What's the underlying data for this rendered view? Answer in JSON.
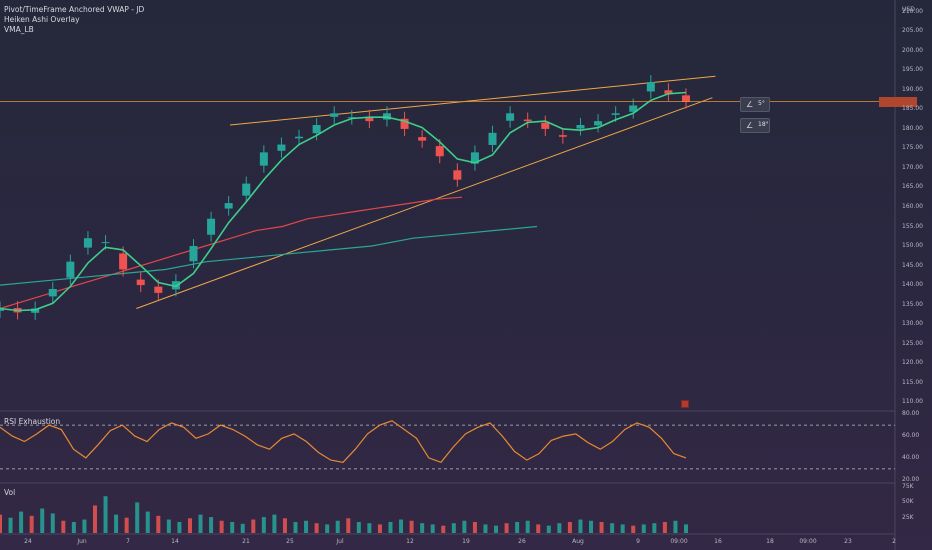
{
  "header": {
    "indicators": [
      "Pivot/TimeFrame Anchored VWAP - JD",
      "Heiken Ashi Overlay",
      "VMA_LB"
    ]
  },
  "price_axis": {
    "currency": "USD",
    "ticks": [
      "210.00",
      "205.00",
      "200.00",
      "195.00",
      "190.00",
      "185.00",
      "180.00",
      "175.00",
      "170.00",
      "165.00",
      "160.00",
      "155.00",
      "150.00",
      "145.00",
      "140.00",
      "135.00",
      "130.00",
      "125.00",
      "120.00",
      "115.00",
      "110.00"
    ]
  },
  "rsi_pane": {
    "label": "RSI Exhaustion",
    "ticks": [
      "80.00",
      "60.00",
      "40.00",
      "20.00"
    ]
  },
  "vol_pane": {
    "label": "Vol",
    "ticks": [
      "75K",
      "50K",
      "25K"
    ]
  },
  "time_axis": {
    "ticks": [
      "24",
      "Jun",
      "7",
      "14",
      "21",
      "25",
      "Jul",
      "12",
      "19",
      "26",
      "Aug",
      "9",
      "09:00",
      "16",
      "18",
      "09:00",
      "23",
      "2"
    ]
  },
  "tools": [
    {
      "icon": "angle-icon",
      "label": "5°"
    },
    {
      "icon": "angle-icon",
      "label": "18°"
    }
  ],
  "colors": {
    "up": "#26a69a",
    "down": "#ef5350",
    "wedge": "#f0a848",
    "vwap1": "#e04848",
    "vwap2": "#2aa890",
    "vma": "#3ccf8a",
    "rsi": "#e88a30",
    "price_line": "#e0923a"
  },
  "chart_data": [
    {
      "type": "line",
      "title": "",
      "series": [
        {
          "values": [
            134,
            133,
            134,
            139,
            146,
            152,
            151,
            144,
            140,
            138,
            141,
            150,
            157,
            161,
            166,
            174,
            176,
            178,
            181,
            184,
            183,
            182,
            184,
            180,
            177,
            173,
            167,
            174,
            179,
            184,
            182,
            180,
            178,
            181,
            182,
            184,
            186,
            192,
            189,
            187
          ]
        },
        {
          "values": [
            134,
            136,
            138,
            140,
            142,
            144,
            146,
            148,
            150,
            152,
            154,
            155,
            157,
            158,
            159,
            160,
            161,
            162,
            162.5
          ]
        },
        {
          "values": [
            140,
            141,
            142,
            143,
            144,
            146,
            147,
            148,
            149,
            150,
            152,
            153,
            154,
            155
          ]
        }
      ],
      "wedge": {
        "upper": [
          [
            0,
            181
          ],
          [
            38,
            193.5
          ]
        ],
        "lower": [
          [
            4,
            134
          ],
          [
            38,
            188
          ]
        ]
      },
      "ylim": [
        108,
        212
      ],
      "yticks": [
        110,
        115,
        120,
        125,
        130,
        135,
        140,
        145,
        150,
        155,
        160,
        165,
        170,
        175,
        180,
        185,
        190,
        195,
        200,
        205,
        210
      ]
    },
    {
      "type": "line",
      "title": "",
      "values": [
        68,
        60,
        55,
        62,
        70,
        66,
        48,
        40,
        52,
        65,
        70,
        60,
        55,
        66,
        72,
        68,
        58,
        62,
        70,
        66,
        60,
        52,
        48,
        58,
        62,
        55,
        45,
        38,
        36,
        48,
        62,
        70,
        74,
        66,
        58,
        40,
        36,
        50,
        62,
        68,
        72,
        60,
        46,
        38,
        44,
        56,
        60,
        62,
        54,
        48,
        55,
        66,
        72,
        68,
        58,
        44,
        40
      ],
      "ylim": [
        18,
        82
      ],
      "yticks": [
        80,
        60,
        40,
        20
      ],
      "bands": [
        70,
        30
      ]
    },
    {
      "type": "bar",
      "title": "",
      "values": [
        30,
        25,
        35,
        28,
        40,
        32,
        20,
        18,
        22,
        45,
        60,
        30,
        25,
        50,
        35,
        28,
        22,
        18,
        24,
        30,
        26,
        20,
        18,
        15,
        22,
        26,
        30,
        24,
        18,
        20,
        16,
        14,
        20,
        24,
        18,
        16,
        14,
        18,
        22,
        20,
        16,
        14,
        12,
        16,
        20,
        18,
        14,
        12,
        16,
        18,
        20,
        14,
        12,
        16,
        18,
        22,
        20,
        18,
        16,
        14,
        12,
        14,
        16,
        18,
        20,
        14
      ],
      "ylim": [
        0,
        80
      ],
      "yticks": [
        25,
        50,
        75
      ]
    }
  ]
}
